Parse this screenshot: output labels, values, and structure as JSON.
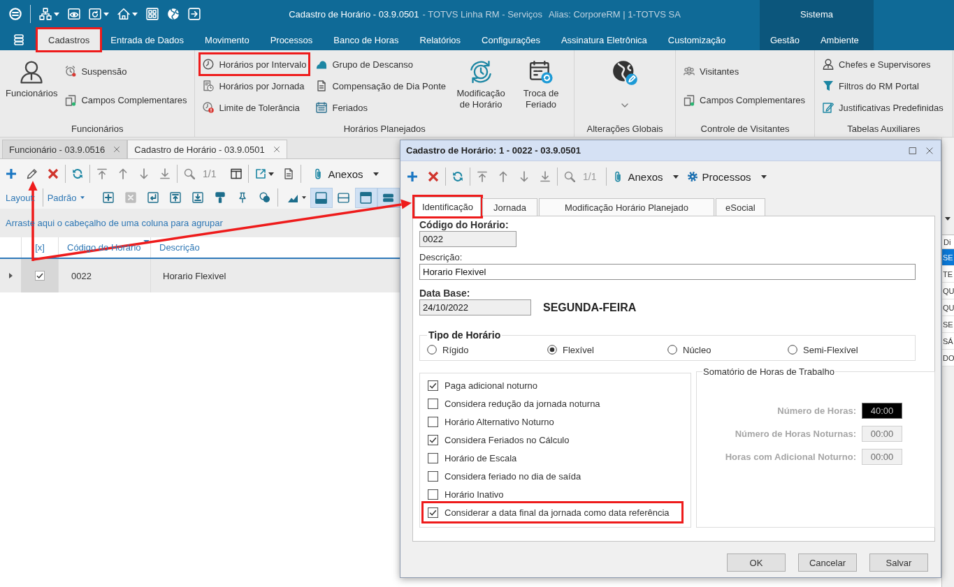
{
  "title_bar": {
    "document": "Cadastro de Horário - 03.9.0501",
    "application": "- TOTVS Linha RM - Serviços",
    "alias": "Alias: CorporeRM | 1-TOTVS SA"
  },
  "menu": {
    "tabs": [
      {
        "label": "Cadastros",
        "selected": true,
        "highlighted": true
      },
      {
        "label": "Entrada de Dados",
        "selected": false,
        "highlighted": false
      },
      {
        "label": "Movimento",
        "selected": false,
        "highlighted": false
      },
      {
        "label": "Processos",
        "selected": false,
        "highlighted": false
      },
      {
        "label": "Banco de Horas",
        "selected": false,
        "highlighted": false
      },
      {
        "label": "Relatórios",
        "selected": false,
        "highlighted": false
      },
      {
        "label": "Configurações",
        "selected": false,
        "highlighted": false
      },
      {
        "label": "Assinatura Eletrônica",
        "selected": false,
        "highlighted": false
      },
      {
        "label": "Customização",
        "selected": false,
        "highlighted": false
      }
    ],
    "context_group": {
      "label": "Sistema",
      "tabs": [
        {
          "label": "Gestão",
          "selected": false
        },
        {
          "label": "Ambiente",
          "selected": false
        }
      ]
    }
  },
  "ribbon": {
    "groups": [
      {
        "label": "Funcionários",
        "items": [
          {
            "kind": "large",
            "label": "Funcionários",
            "highlighted": false
          },
          {
            "kind": "small",
            "label": "Suspensão",
            "highlighted": false
          },
          {
            "kind": "small",
            "label": "Campos Complementares",
            "highlighted": false
          }
        ]
      },
      {
        "label": "Horários Planejados",
        "items": [
          {
            "kind": "small",
            "label": "Horários por Intervalo",
            "highlighted": true
          },
          {
            "kind": "small",
            "label": "Horários por Jornada",
            "highlighted": false
          },
          {
            "kind": "small",
            "label": "Limite de Tolerância",
            "highlighted": false
          },
          {
            "kind": "small",
            "label": "Grupo de Descanso",
            "highlighted": false
          },
          {
            "kind": "small",
            "label": "Compensação de Dia Ponte",
            "highlighted": false
          },
          {
            "kind": "small",
            "label": "Feriados",
            "highlighted": false
          },
          {
            "kind": "large",
            "label": "Modificação de Horário",
            "highlighted": false
          },
          {
            "kind": "large",
            "label": "Troca de Feriado",
            "highlighted": false
          }
        ]
      },
      {
        "label": "Alterações Globais",
        "items": [
          {
            "kind": "icon_menu",
            "highlighted": false
          }
        ]
      },
      {
        "label": "Controle de Visitantes",
        "items": [
          {
            "kind": "small",
            "label": "Visitantes",
            "highlighted": false
          },
          {
            "kind": "small",
            "label": "Campos Complementares",
            "highlighted": false
          }
        ]
      },
      {
        "label": "Tabelas Auxiliares",
        "items": [
          {
            "kind": "small",
            "label": "Chefes e Supervisores",
            "highlighted": false
          },
          {
            "kind": "small",
            "label": "Filtros do RM Portal",
            "highlighted": false
          },
          {
            "kind": "small",
            "label": "Justificativas Predefinidas",
            "highlighted": false
          }
        ]
      }
    ]
  },
  "document_tabs": [
    {
      "label": "Funcionário - 03.9.0516",
      "selected": false
    },
    {
      "label": "Cadastro de Horário - 03.9.0501",
      "selected": true
    }
  ],
  "toolbar": {
    "record_counter": "1/1",
    "attachments": "Anexos"
  },
  "layout_bar": {
    "label": "Layout:",
    "layout": "Padrão",
    "view_toggles": [
      {
        "selected": true
      },
      {
        "selected": false
      },
      {
        "selected": true
      },
      {
        "selected": true
      }
    ]
  },
  "group_panel": {
    "hint": "Arraste aqui o cabeçalho de uma coluna para agrupar"
  },
  "grid": {
    "columns": [
      {
        "label": "[x]",
        "sorted": false
      },
      {
        "label": "Código do Horário",
        "sorted": true
      },
      {
        "label": "Descrição",
        "sorted": false
      }
    ],
    "rows": [
      {
        "checked": true,
        "selected": true,
        "code": "0022",
        "description": "Horario Flexivel"
      }
    ]
  },
  "side_grid": {
    "column_1": "Di",
    "rows": [
      {
        "cell": "SE",
        "selected": true
      },
      {
        "cell": "TE",
        "selected": false
      },
      {
        "cell": "QU",
        "selected": false
      },
      {
        "cell": "QU",
        "selected": false
      },
      {
        "cell": "SE",
        "selected": false
      },
      {
        "cell": "SÁ",
        "selected": false
      },
      {
        "cell": "DO",
        "selected": false
      }
    ]
  },
  "dialog": {
    "title": "Cadastro de Horário: 1 - 0022 - 03.9.0501",
    "toolbar": {
      "record_counter": "1/1",
      "attachments": "Anexos",
      "processes": "Processos"
    },
    "tabs": [
      {
        "label": "Identificação",
        "selected": true,
        "highlighted": true
      },
      {
        "label": "Jornada",
        "selected": false,
        "highlighted": false
      },
      {
        "label": "Modificação Horário Planejado",
        "selected": false,
        "highlighted": false
      },
      {
        "label": "eSocial",
        "selected": false,
        "highlighted": false
      }
    ],
    "code": {
      "label": "Código do Horário:",
      "value": "0022"
    },
    "description": {
      "label": "Descrição:",
      "value": "Horario Flexivel"
    },
    "base_date": {
      "label": "Data Base:",
      "value": "24/10/2022",
      "weekday": "SEGUNDA-FEIRA"
    },
    "schedule_type": {
      "title": "Tipo de Horário",
      "options": [
        {
          "label": "Rígido",
          "selected": false
        },
        {
          "label": "Flexível",
          "selected": true
        },
        {
          "label": "Núcleo",
          "selected": false
        },
        {
          "label": "Semi-Flexível",
          "selected": false
        }
      ]
    },
    "options": [
      {
        "label": "Paga adicional noturno",
        "checked": true,
        "highlighted": false
      },
      {
        "label": "Considera redução da jornada noturna",
        "checked": false,
        "highlighted": false
      },
      {
        "label": "Horário Alternativo Noturno",
        "checked": false,
        "highlighted": false
      },
      {
        "label": "Considera Feriados no Cálculo",
        "checked": true,
        "highlighted": false
      },
      {
        "label": "Horário de Escala",
        "checked": false,
        "highlighted": false
      },
      {
        "label": "Considera feriado no dia de saída",
        "checked": false,
        "highlighted": false
      },
      {
        "label": "Horário Inativo",
        "checked": false,
        "highlighted": false
      },
      {
        "label": "Considerar a data final da jornada como data referência",
        "checked": true,
        "highlighted": true
      }
    ],
    "hours_summary": {
      "title": "Somatório de Horas de Trabalho",
      "disabled": true,
      "fields": [
        {
          "label": "Número de Horas:",
          "value": "40:00",
          "selected": true
        },
        {
          "label": "Número de Horas Noturnas:",
          "value": "00:00",
          "selected": false
        },
        {
          "label": "Horas com Adicional Noturno:",
          "value": "00:00",
          "selected": false
        }
      ]
    },
    "buttons": [
      "OK",
      "Cancelar",
      "Salvar"
    ]
  }
}
